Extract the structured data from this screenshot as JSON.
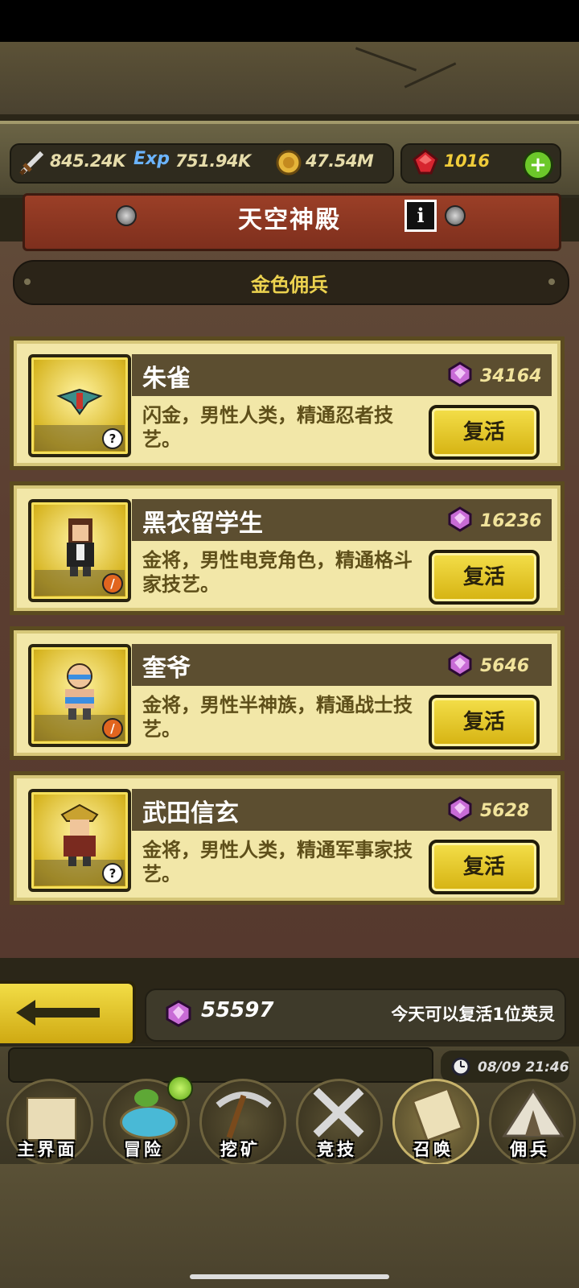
{
  "resources": {
    "attack": "845.24K",
    "exp_icon_label": "Exp",
    "exp": "751.94K",
    "gold": "47.54M",
    "rubies": "1016"
  },
  "header": {
    "title": "天空神殿"
  },
  "section": {
    "title": "金色佣兵"
  },
  "heroes": [
    {
      "name": "朱雀",
      "cost": "34164",
      "desc": "闪金，男性人类，精通忍者技艺。",
      "button": "复活",
      "badge": "?"
    },
    {
      "name": "黑衣留学生",
      "cost": "16236",
      "desc": "金将，男性电竞角色，精通格斗家技艺。",
      "button": "复活",
      "badge": "sword"
    },
    {
      "name": "奎爷",
      "cost": "5646",
      "desc": "金将，男性半神族，精通战士技艺。",
      "button": "复活",
      "badge": "sword"
    },
    {
      "name": "武田信玄",
      "cost": "5628",
      "desc": "金将，男性人类，精通军事家技艺。",
      "button": "复活",
      "badge": "?"
    }
  ],
  "footer": {
    "gems": "55597",
    "note": "今天可以复活1位英灵"
  },
  "time": "08/09 21:46",
  "nav": [
    {
      "label": "主界面"
    },
    {
      "label": "冒险"
    },
    {
      "label": "挖矿"
    },
    {
      "label": "竞技"
    },
    {
      "label": "召唤"
    },
    {
      "label": "佣兵"
    }
  ],
  "colors": {
    "accent_gold": "#ecd24f",
    "banner_red": "#9b3f27",
    "card_bg": "#f2e7a8"
  }
}
